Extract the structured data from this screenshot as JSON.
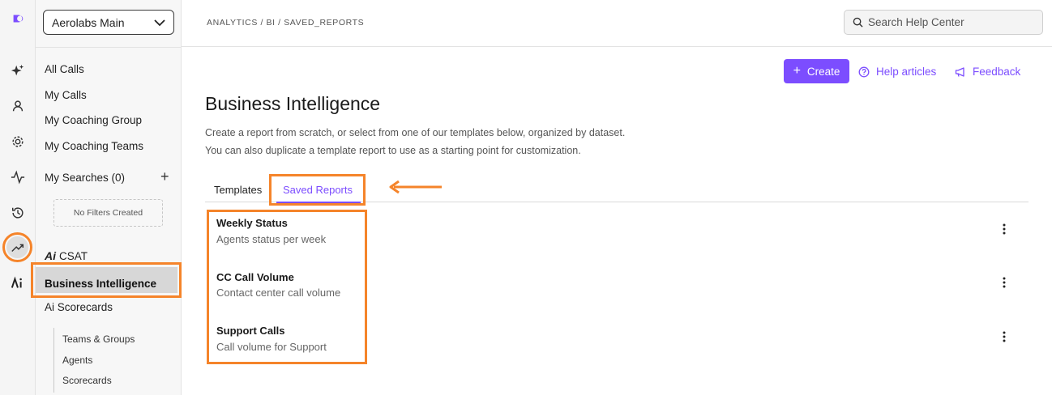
{
  "colors": {
    "accent": "#7c4dff",
    "highlight": "#f5842a"
  },
  "rail": {
    "icons": [
      "logo-icon",
      "sparkle-icon",
      "user-icon",
      "gear-icon",
      "activity-icon",
      "history-icon",
      "trending-up-icon",
      "ai-icon"
    ]
  },
  "sidebar": {
    "org_select": "Aerolabs Main",
    "items": [
      "All Calls",
      "My Calls",
      "My Coaching Group",
      "My Coaching Teams"
    ],
    "searches_label": "My Searches (0)",
    "no_filters": "No Filters Created",
    "csat_label": "CSAT",
    "csat_mark": "Ai",
    "bi_label": "Business Intelligence",
    "scorecards_label": "Ai Scorecards",
    "sub_items": [
      "Teams & Groups",
      "Agents",
      "Scorecards"
    ]
  },
  "header": {
    "breadcrumb": "ANALYTICS / BI / SAVED_REPORTS",
    "search_placeholder": "Search Help Center"
  },
  "actions": {
    "create": "Create",
    "help": "Help articles",
    "feedback": "Feedback"
  },
  "main": {
    "title": "Business Intelligence",
    "desc1": "Create a report from scratch, or select from one of our templates below, organized by dataset.",
    "desc2": "You can also duplicate a template report to use as a starting point for customization.",
    "tabs": [
      "Templates",
      "Saved Reports"
    ],
    "reports": [
      {
        "title": "Weekly Status",
        "subtitle": "Agents status per week"
      },
      {
        "title": "CC Call Volume",
        "subtitle": "Contact center call volume"
      },
      {
        "title": "Support Calls",
        "subtitle": "Call volume for Support"
      }
    ]
  }
}
